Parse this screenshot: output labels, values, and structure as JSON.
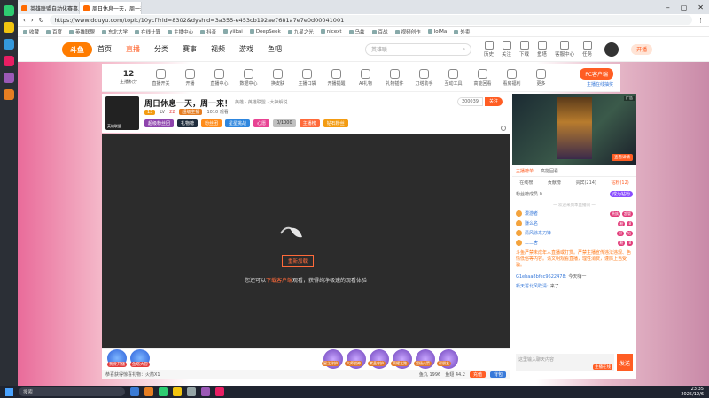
{
  "browser": {
    "tabs": [
      {
        "title": "英雄联盟自动化赛事..."
      },
      {
        "title": "周日休息一天，周一来！"
      }
    ],
    "url": "https://www.douyu.com/topic/10ycf?rid=8302&dyshid=3a355-e453cb192ae7681a7e7e0d00041001",
    "bookmarks": [
      "收藏",
      "百度",
      "英雄联盟",
      "东北大学",
      "在线计算",
      "主播中心",
      "抖音",
      "yiibai",
      "DeepSeek",
      "九星之光",
      "nicext",
      "乌兹",
      "百战",
      "视频创作",
      "IoIMa",
      "外卖"
    ]
  },
  "topnav": {
    "logo": "斗鱼",
    "items": [
      "首页",
      "直播",
      "分类",
      "赛事",
      "视频",
      "游戏",
      "鱼吧"
    ],
    "active_index": 1,
    "search_placeholder": "英雄联",
    "icons": [
      "历史",
      "关注",
      "下载",
      "鱼塔",
      "客服中心",
      "任务"
    ],
    "open_live": "开播"
  },
  "tools": {
    "level_value": "12",
    "level_label": "主播积分",
    "items": [
      "直播开关",
      "开播",
      "直播中心",
      "数据中心",
      "换皮肤",
      "主播口袋",
      "开播提醒",
      "AI礼物",
      "礼物插件",
      "刀塔助手",
      "互动工具",
      "高能回看",
      "看房福利",
      "更多"
    ],
    "pc_client": "PC客户端",
    "pc_sub": "主播在线抽奖"
  },
  "room": {
    "title": "周日休息一天，周一来！",
    "categories": "英雄 · 英雄联盟 · 大神解说",
    "anchor": "英雄联盟",
    "level_badge": "13",
    "meta": [
      "LV",
      "22",
      "超级主播",
      "1010 观看"
    ],
    "tags": [
      "超级粉丝团",
      "礼物榜",
      "粉丝团",
      "星星挑战",
      "心愿",
      "0/1000",
      "主播榜",
      "钻石粉丝"
    ],
    "follow_count": "300039",
    "follow_label": "关注"
  },
  "player": {
    "button": "重新加载",
    "tip_prefix": "您还可以",
    "tip_link": "下载客户端",
    "tip_suffix": "观看，获得纯净极速的观看体验",
    "gifts_left": [
      "我要开播",
      "鱼塔大冒"
    ],
    "gifts_right": [
      "星之守护",
      "大师战神",
      "紫晶守护",
      "荣耀之路",
      "超级火箭",
      "帮朋友"
    ],
    "strip_text": "恭喜获得惊喜礼物：火箭X1",
    "strip_right": [
      "鱼丸 1996",
      "鱼翅 44.2",
      "充值",
      "背包"
    ]
  },
  "side": {
    "ad_tag": "广告",
    "ad_button": "查看详情",
    "rank_tabs": [
      "主播榜单",
      "高能回看"
    ],
    "chat_tabs": [
      "在线榜",
      "贡献榜",
      "贵宾(214)",
      "钻粉(12)"
    ],
    "fan_row_label": "粉丝榜成员 0",
    "fan_row_pill": "成为钻粉",
    "sys_note": "一 欢迎来到本直播间 一",
    "users": [
      {
        "name": "漫游者",
        "pills": [
          "贵族",
          "超管"
        ]
      },
      {
        "name": "赚么名",
        "pills": [
          "粉",
          "8"
        ]
      },
      {
        "name": "清风徐来刀锋",
        "pills": [
          "粉",
          "钻"
        ]
      },
      {
        "name": "二二舍",
        "pills": [
          "粉",
          "8"
        ]
      }
    ],
    "warning": "斗鱼严禁未成年人直播或打赏。严禁主播宣传违法违规、色情低俗等内容。请文明观看直播，理性消费，谨防上当受骗。",
    "messages": [
      {
        "name": "G1ebaa8bfec9622478:",
        "text": "今天嗨一"
      },
      {
        "name": "新天誓北风吹清:",
        "text": "来了"
      }
    ],
    "input_placeholder": "这里输入聊天内容",
    "input_badge": "主播在线",
    "send": "发送"
  },
  "taskbar": {
    "search": "搜索",
    "time": "23:35",
    "date": "2025/12/6"
  },
  "colors": {
    "accent": "#ff5d23",
    "link": "#3879d9"
  }
}
